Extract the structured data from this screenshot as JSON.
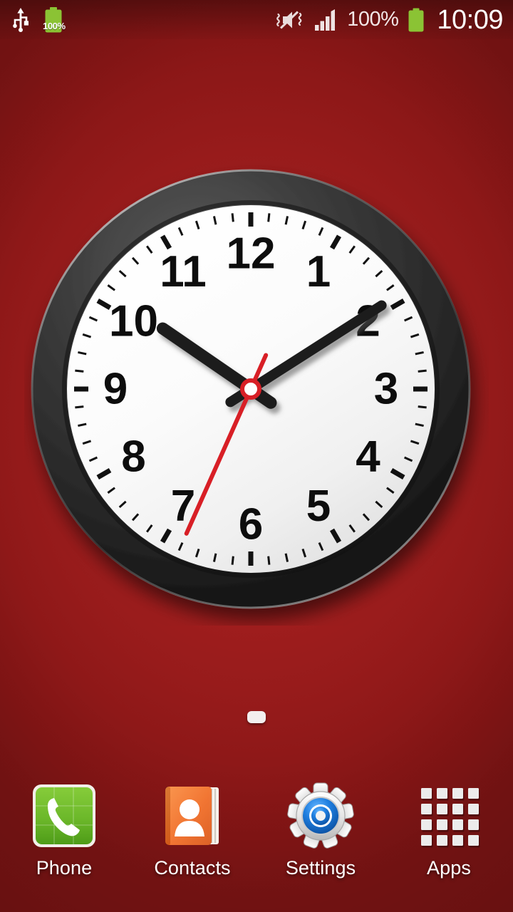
{
  "wallpaper": {
    "base_color": "#a61f1f",
    "edge_color": "#7c1414",
    "description": "solid dark red radial gradient"
  },
  "statusbar": {
    "usb_icon": "usb-icon",
    "battery_left_icon": "battery-charging-icon",
    "battery_left_percent": "100%",
    "mute_icon": "mute-vibrate-icon",
    "signal_icon": "signal-bars-icon",
    "battery_percent": "100%",
    "battery_icon": "battery-full-icon",
    "time": "10:09",
    "text_color": "#ffffff",
    "battery_color": "#8bc334"
  },
  "clock_widget": {
    "name": "analog-clock-widget",
    "displayed_time": "10:09",
    "hour": 10,
    "minute": 9,
    "second": 34,
    "numerals": [
      "12",
      "1",
      "2",
      "3",
      "4",
      "5",
      "6",
      "7",
      "8",
      "9",
      "10",
      "11"
    ],
    "bezel_color": "#2e2e2e",
    "face_color": "#fbfbfb",
    "hand_color": "#1a1a1a",
    "second_hand_color": "#d81f26",
    "hub_color": "#d81f26",
    "tick_color": "#111111"
  },
  "page_indicator": {
    "name": "home-screen-page-indicator",
    "total_pages": 1,
    "current_page": 1,
    "active_color": "#f3eeee"
  },
  "dock": {
    "items": [
      {
        "label": "Phone",
        "icon": "phone-icon",
        "color": "#60b022"
      },
      {
        "label": "Contacts",
        "icon": "contacts-icon",
        "color": "#f26b21"
      },
      {
        "label": "Settings",
        "icon": "settings-gear-icon",
        "color": "#1a73d8"
      },
      {
        "label": "Apps",
        "icon": "apps-grid-icon",
        "color": "#e8e8e8"
      }
    ]
  }
}
